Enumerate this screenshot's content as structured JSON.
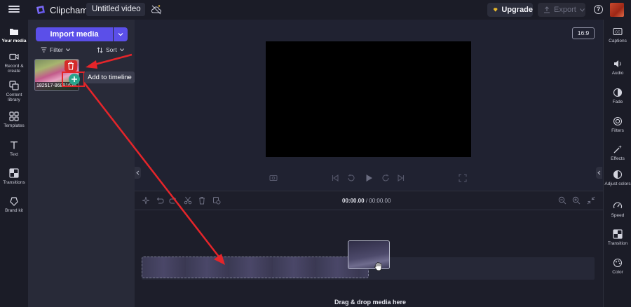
{
  "topbar": {
    "app_name": "Clipchamp",
    "project_title": "Untitled video",
    "upgrade_label": "Upgrade",
    "export_label": "Export",
    "help_label": "?"
  },
  "left_rail": {
    "items": [
      {
        "label": "Your media",
        "icon": "folder-icon",
        "active": true
      },
      {
        "label": "Record & create",
        "icon": "camera-icon"
      },
      {
        "label": "Content library",
        "icon": "library-icon"
      },
      {
        "label": "Templates",
        "icon": "templates-icon"
      },
      {
        "label": "Text",
        "icon": "text-icon"
      },
      {
        "label": "Transitions",
        "icon": "transitions-icon"
      },
      {
        "label": "Brand kit",
        "icon": "brand-kit-icon"
      }
    ]
  },
  "media_panel": {
    "import_label": "Import media",
    "filter_label": "Filter",
    "sort_label": "Sort",
    "asset_name": "182517-86891636...",
    "tooltip": "Add to timeline"
  },
  "stage": {
    "aspect_ratio": "16:9"
  },
  "timeline": {
    "current_time": "00:00.00",
    "total_time": "00:00.00",
    "drop_hint": "Drag & drop media here"
  },
  "right_rail": {
    "items": [
      {
        "label": "Captions",
        "icon": "captions-icon"
      },
      {
        "label": "Audio",
        "icon": "speaker-icon"
      },
      {
        "label": "Fade",
        "icon": "fade-icon"
      },
      {
        "label": "Filters",
        "icon": "filters-icon"
      },
      {
        "label": "Effects",
        "icon": "effects-icon"
      },
      {
        "label": "Adjust colors",
        "icon": "adjust-colors-icon"
      },
      {
        "label": "Speed",
        "icon": "speed-icon"
      },
      {
        "label": "Transition",
        "icon": "transition-icon"
      },
      {
        "label": "Color",
        "icon": "color-icon"
      }
    ]
  },
  "colors": {
    "accent": "#5b4fe9",
    "delete": "#d52a2a",
    "add": "#29a58c",
    "annotation": "#e5252a"
  }
}
